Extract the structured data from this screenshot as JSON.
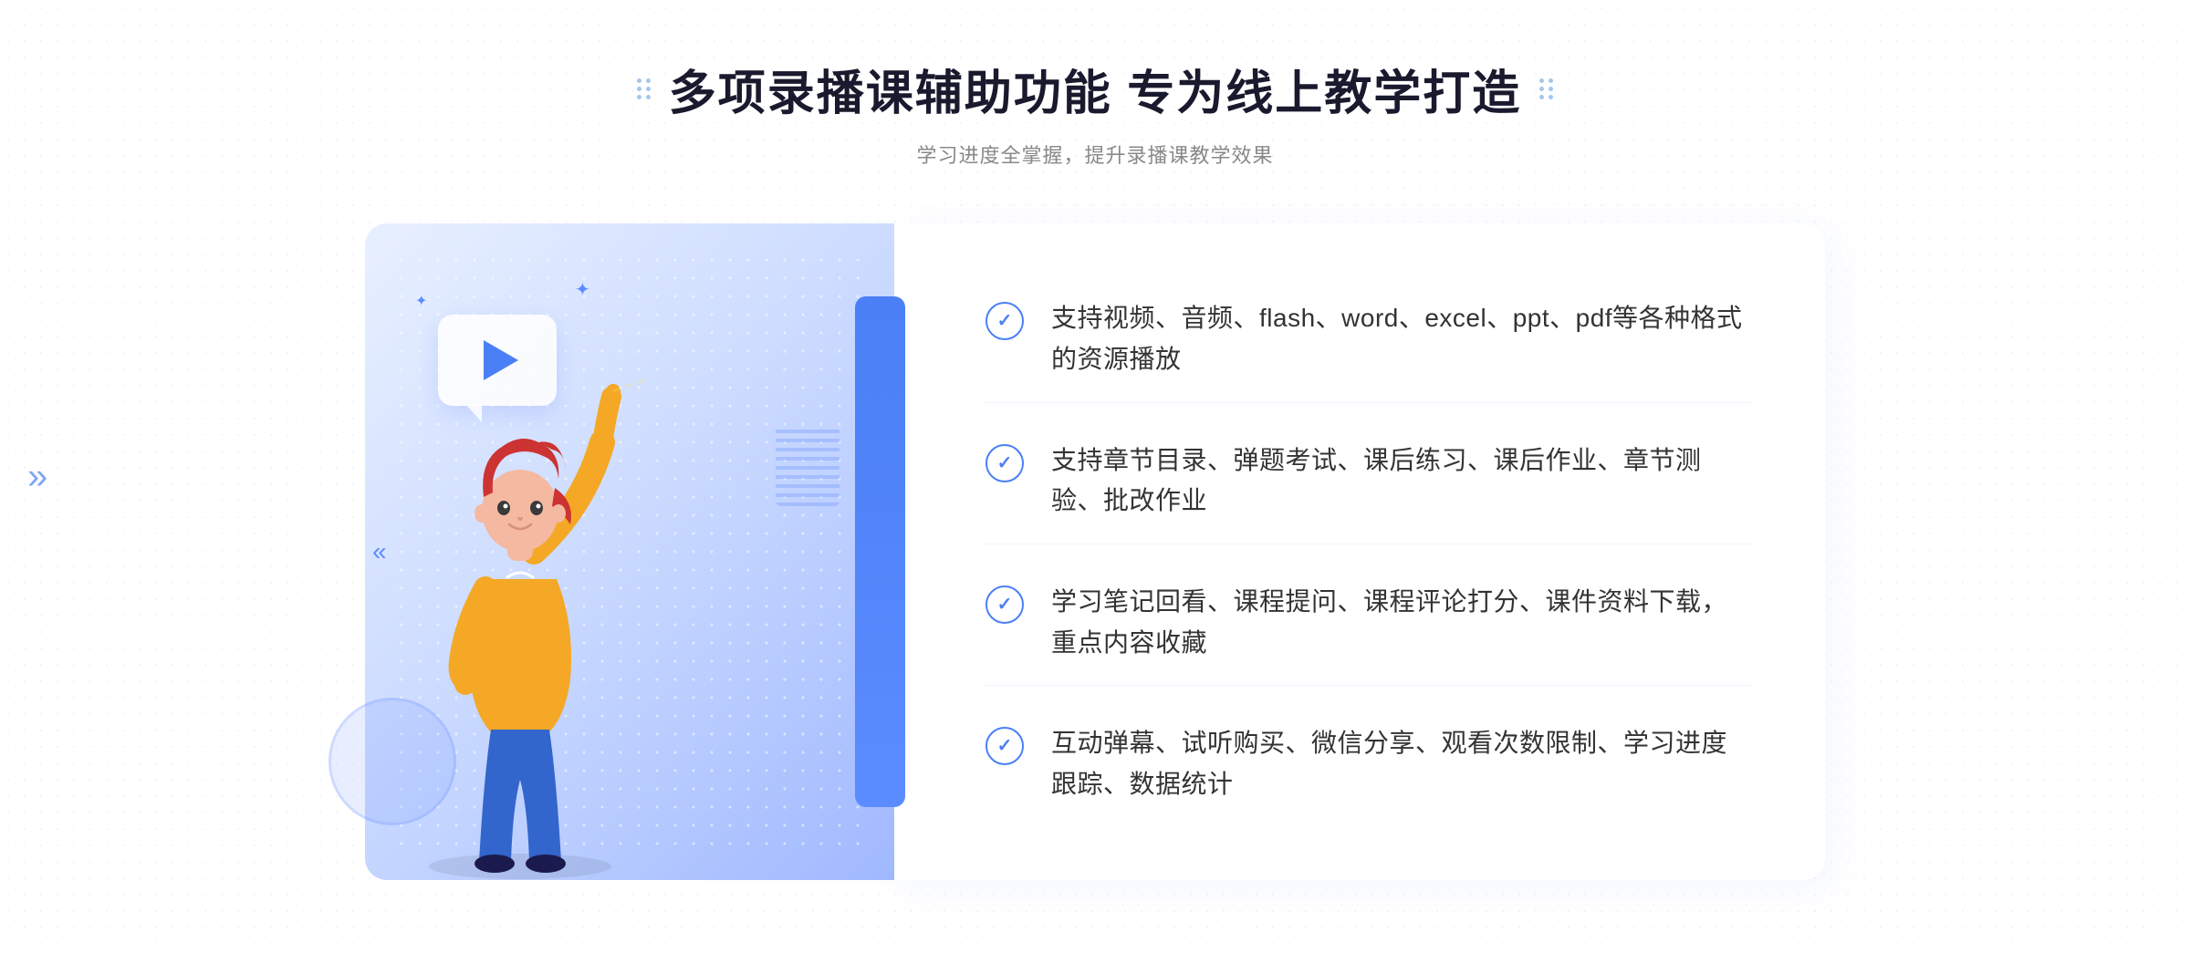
{
  "page": {
    "title": "多项录播课辅助功能 专为线上教学打造",
    "subtitle": "学习进度全掌握，提升录播课教学效果"
  },
  "decorations": {
    "arrows_left": "»",
    "dots_left_label": "title-dots-left",
    "dots_right_label": "title-dots-right"
  },
  "features": [
    {
      "id": 1,
      "text": "支持视频、音频、flash、word、excel、ppt、pdf等各种格式的资源播放"
    },
    {
      "id": 2,
      "text": "支持章节目录、弹题考试、课后练习、课后作业、章节测验、批改作业"
    },
    {
      "id": 3,
      "text": "学习笔记回看、课程提问、课程评论打分、课件资料下载，重点内容收藏"
    },
    {
      "id": 4,
      "text": "互动弹幕、试听购买、微信分享、观看次数限制、学习进度跟踪、数据统计"
    }
  ],
  "illustration": {
    "play_button_label": "play-button",
    "person_label": "person-figure"
  },
  "colors": {
    "primary": "#4a7ff5",
    "secondary": "#5b8cff",
    "text_dark": "#1a1a2e",
    "text_gray": "#888888",
    "text_body": "#333333",
    "bg_gradient_start": "#e8f0ff",
    "bg_gradient_end": "#a0b8ff"
  }
}
